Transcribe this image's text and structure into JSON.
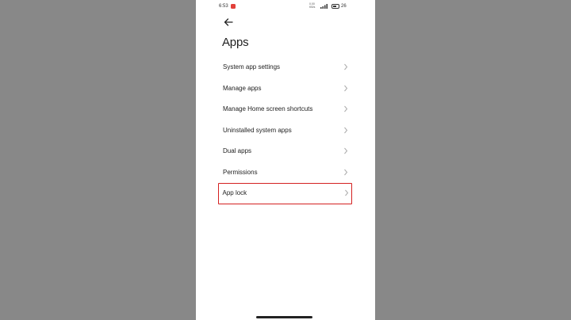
{
  "status_bar": {
    "time": "6:53",
    "network_line1": "0.00",
    "network_line2": "KB/s",
    "battery_percent": "26"
  },
  "header": {
    "title": "Apps"
  },
  "menu": {
    "items": [
      {
        "label": "System app settings"
      },
      {
        "label": "Manage apps"
      },
      {
        "label": "Manage Home screen shortcuts"
      },
      {
        "label": "Uninstalled system apps"
      },
      {
        "label": "Dual apps"
      },
      {
        "label": "Permissions"
      },
      {
        "label": "App lock",
        "highlighted": true
      }
    ]
  },
  "colors": {
    "highlight_border": "#d42020",
    "notification_icon": "#e2403a",
    "page_background": "#ffffff",
    "outer_background": "#888888"
  },
  "icons": {
    "back": "arrow-left-icon",
    "chevron": "chevron-right-icon",
    "notification": "app-notification-icon"
  }
}
